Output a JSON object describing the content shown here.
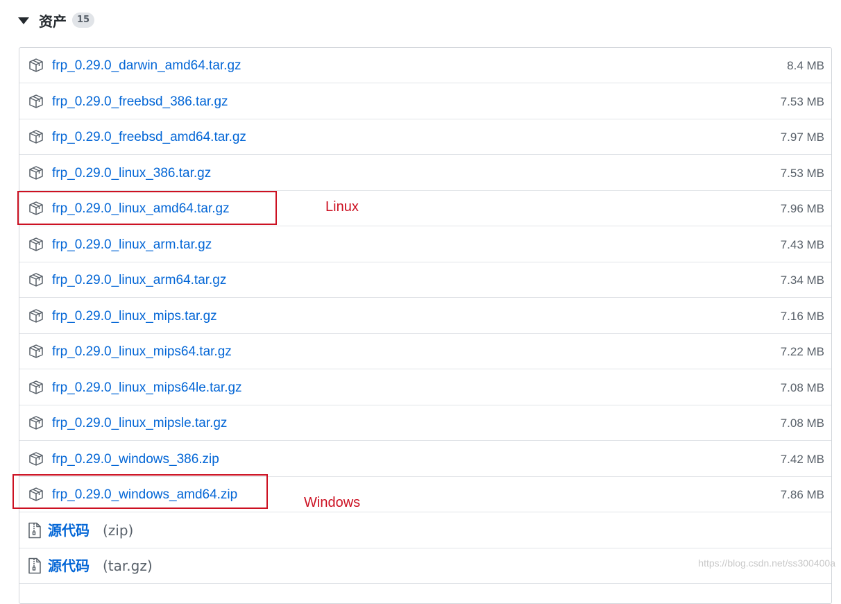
{
  "section": {
    "title": "资产",
    "count": "15"
  },
  "assets": [
    {
      "name": "frp_0.29.0_darwin_amd64.tar.gz",
      "size": "8.4 MB"
    },
    {
      "name": "frp_0.29.0_freebsd_386.tar.gz",
      "size": "7.53 MB"
    },
    {
      "name": "frp_0.29.0_freebsd_amd64.tar.gz",
      "size": "7.97 MB"
    },
    {
      "name": "frp_0.29.0_linux_386.tar.gz",
      "size": "7.53 MB"
    },
    {
      "name": "frp_0.29.0_linux_amd64.tar.gz",
      "size": "7.96 MB"
    },
    {
      "name": "frp_0.29.0_linux_arm.tar.gz",
      "size": "7.43 MB"
    },
    {
      "name": "frp_0.29.0_linux_arm64.tar.gz",
      "size": "7.34 MB"
    },
    {
      "name": "frp_0.29.0_linux_mips.tar.gz",
      "size": "7.16 MB"
    },
    {
      "name": "frp_0.29.0_linux_mips64.tar.gz",
      "size": "7.22 MB"
    },
    {
      "name": "frp_0.29.0_linux_mips64le.tar.gz",
      "size": "7.08 MB"
    },
    {
      "name": "frp_0.29.0_linux_mipsle.tar.gz",
      "size": "7.08 MB"
    },
    {
      "name": "frp_0.29.0_windows_386.zip",
      "size": "7.42 MB"
    },
    {
      "name": "frp_0.29.0_windows_amd64.zip",
      "size": "7.86 MB"
    }
  ],
  "source": [
    {
      "label": "源代码",
      "format": "(zip)"
    },
    {
      "label": "源代码",
      "format": "(tar.gz)"
    }
  ],
  "annotations": {
    "linux": "Linux",
    "windows": "Windows",
    "color": "#cc1122"
  },
  "watermark": "https://blog.csdn.net/ss300400a",
  "icons": {
    "asset": "package-icon",
    "source": "zip-file-icon",
    "toggle": "triangle-down-icon"
  },
  "colors": {
    "link": "#0366d6",
    "muted": "#586069",
    "border": "#e1e4e8"
  }
}
